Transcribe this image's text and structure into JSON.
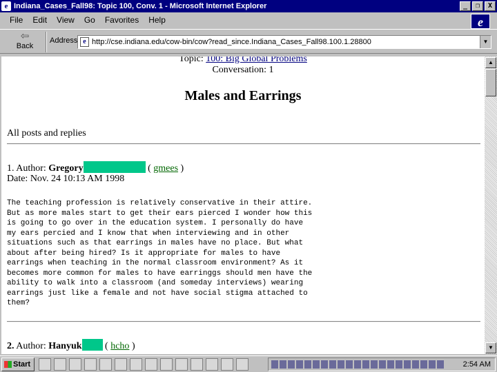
{
  "window": {
    "title": "Indiana_Cases_Fall98: Topic 100, Conv. 1 - Microsoft Internet Explorer",
    "minimize": "_",
    "maximize": "❐",
    "close": "X"
  },
  "menu": [
    "File",
    "Edit",
    "View",
    "Go",
    "Favorites",
    "Help"
  ],
  "toolbar": {
    "back_label": "Back",
    "address_label": "Address",
    "address_value": "http://cse.indiana.edu/cow-bin/cow?read_since.Indiana_Cases_Fall98.100.1.28800"
  },
  "page": {
    "topic_prefix": "Topic:",
    "topic_link": "100: Big Global Problems",
    "conversation": "Conversation: 1",
    "title": "Males and Earrings",
    "all_posts": "All posts and replies",
    "posts": [
      {
        "number": "1.",
        "author_label": "Author:",
        "author": "Gregory",
        "user_link": "gmees",
        "date": "Date: Nov. 24 10:13 AM 1998",
        "body": "The teaching profession is relatively conservative in their attire.\nBut as more males start to get their ears pierced I wonder how this\nis going to go over in the education system. I personally do have\nmy ears percied and I know that when interviewing and in other\nsituations such as that earrings in males have no place. But what\nabout after being hired? Is it appropriate for males to have\nearrings when teaching in the normal classroom environment? As it\nbecomes more common for males to have earringgs should men have the\nability to walk into a classroom (and someday interviews) wearing\nearrings just like a female and not have social stigma attached to\nthem?"
      },
      {
        "number": "2.",
        "author_label": "Author:",
        "author": "Hanyuk",
        "user_link": "hcho"
      }
    ]
  },
  "taskbar": {
    "start_label": "Start",
    "clock": "2:54 AM"
  }
}
